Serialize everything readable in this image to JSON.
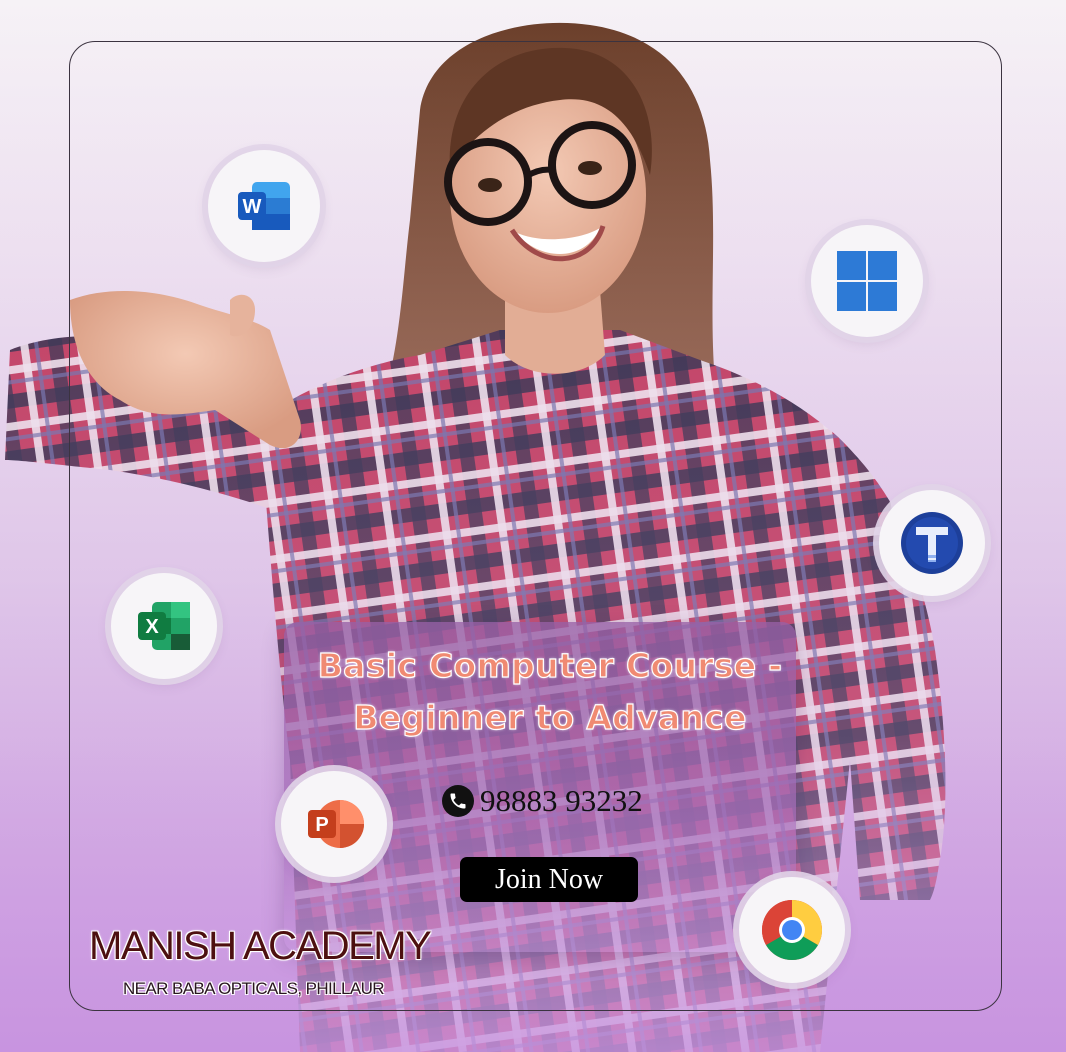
{
  "headline": {
    "line1": "Basic Computer Course -",
    "line2": "Beginner to Advance"
  },
  "contact": {
    "phone": "98883 93232"
  },
  "cta": {
    "label": "Join Now"
  },
  "brand": {
    "name": "MANISH ACADEMY",
    "address": "NEAR BABA OPTICALS, PHILLAUR"
  },
  "icons": [
    "ms-word-icon",
    "windows-icon",
    "typing-tutor-icon",
    "ms-excel-icon",
    "ms-powerpoint-icon",
    "chrome-icon",
    "phone-icon"
  ],
  "colors": {
    "headline": "#f08a72",
    "brand": "#4d1010",
    "button": "#000000",
    "background_top": "#f6f2f6",
    "background_bottom": "#c894e0"
  }
}
